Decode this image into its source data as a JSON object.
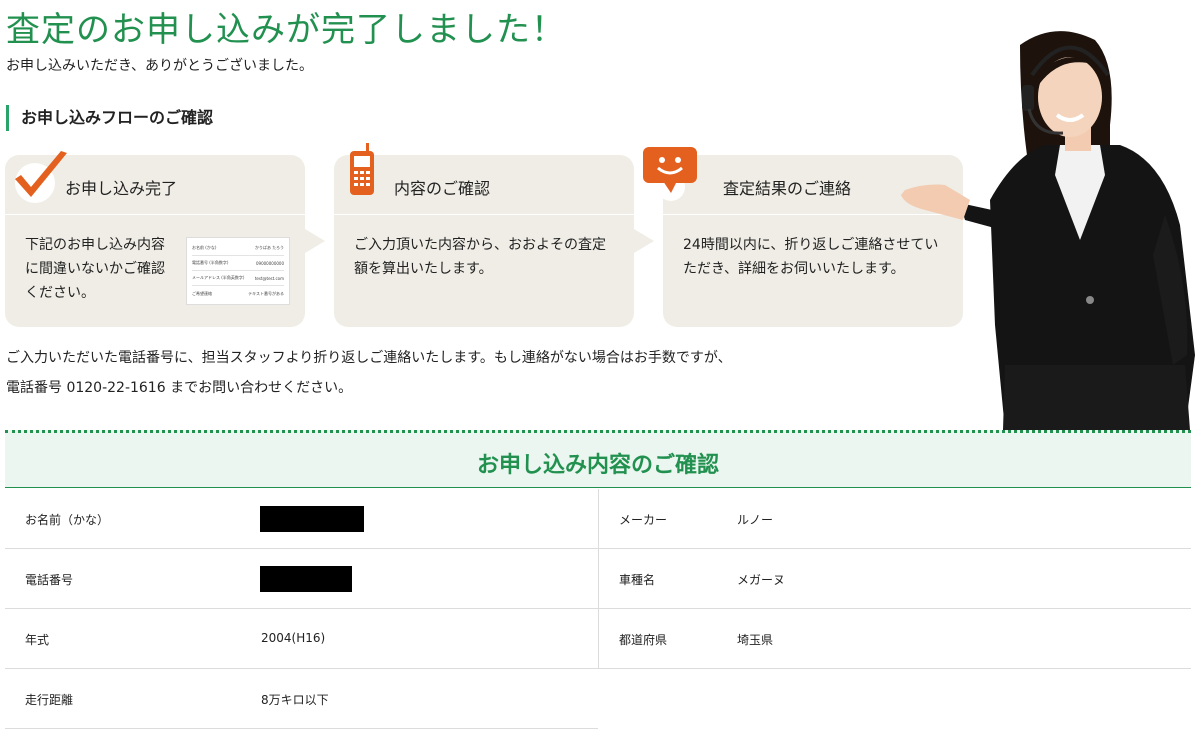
{
  "header": {
    "title": "査定のお申し込みが完了しました！",
    "subtitle": "お申し込みいただき、ありがとうございました。"
  },
  "flow": {
    "heading": "お申し込みフローのご確認",
    "steps": [
      {
        "icon": "checkmark-icon",
        "title": "お申し込み完了",
        "body": "下記のお申し込み内容に間違いないかご確認ください。"
      },
      {
        "icon": "mobile-phone-icon",
        "title": "内容のご確認",
        "body": "ご入力頂いた内容から、おおよその査定額を算出いたします。"
      },
      {
        "icon": "smiling-chat-bubble-icon",
        "title": "査定結果のご連絡",
        "body": "24時間以内に、折り返しご連絡させていただき、詳細をお伺いいたします。"
      }
    ],
    "sample_form": [
      {
        "label": "お名前 (かな)",
        "value": "かりばあ たろう"
      },
      {
        "label": "電話番号 (半角数字)",
        "value": "09000000000"
      },
      {
        "label": "メールアドレス (半角英数字)",
        "value": "test@test.com"
      },
      {
        "label": "ご希望連絡",
        "value": "テキスト番号がある"
      }
    ]
  },
  "notice": {
    "line1": "ご入力いただいた電話番号に、担当スタッフより折り返しご連絡いたします。もし連絡がない場合はお手数ですが、",
    "line2": "電話番号 0120-22-1616 までお問い合わせください。"
  },
  "confirmation": {
    "title": "お申し込み内容のご確認",
    "left": [
      {
        "label": "お名前（かな）",
        "value": ""
      },
      {
        "label": "電話番号",
        "value": ""
      },
      {
        "label": "年式",
        "value": "2004(H16)"
      },
      {
        "label": "走行距離",
        "value": "8万キロ以下"
      }
    ],
    "right": [
      {
        "label": "メーカー",
        "value": "ルノー"
      },
      {
        "label": "車種名",
        "value": "メガーヌ"
      },
      {
        "label": "都道府県",
        "value": "埼玉県"
      }
    ]
  },
  "colors": {
    "accent_green": "#229150",
    "card_bg": "#efede5",
    "icon_orange": "#e4601f",
    "band_bg": "#eaf6ef"
  }
}
